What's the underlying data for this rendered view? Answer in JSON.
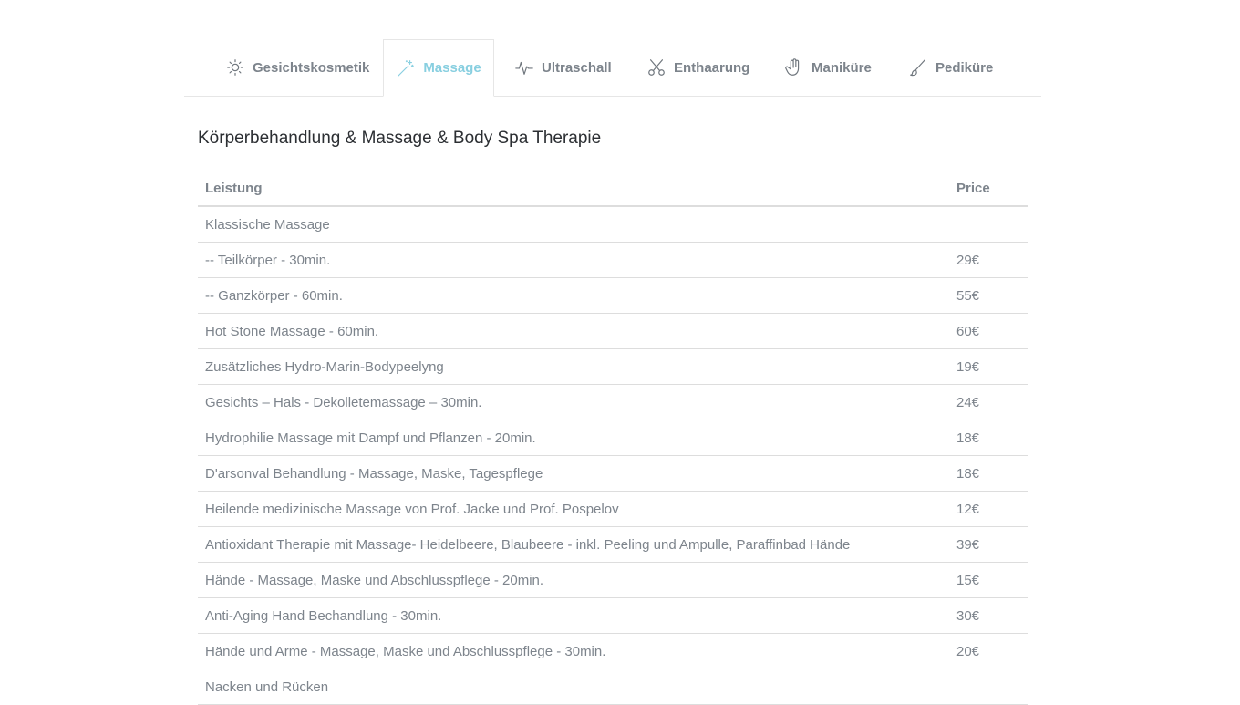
{
  "tabs": [
    {
      "label": "Gesichtskosmetik",
      "icon": "sun-icon"
    },
    {
      "label": "Massage",
      "icon": "magic-wand-icon",
      "active": true
    },
    {
      "label": "Ultraschall",
      "icon": "pulse-icon"
    },
    {
      "label": "Enthaarung",
      "icon": "scissors-icon"
    },
    {
      "label": "Maniküre",
      "icon": "hand-icon"
    },
    {
      "label": "Pediküre",
      "icon": "brush-icon"
    }
  ],
  "colors": {
    "accent": "#88cfe0",
    "text": "#7d848c",
    "title": "#2c2f33",
    "border": "#dddddd"
  },
  "section": {
    "title": "Körperbehandlung & Massage & Body Spa Therapie"
  },
  "table": {
    "headers": {
      "service": "Leistung",
      "price": "Price"
    },
    "rows": [
      {
        "service": "Klassische Massage",
        "price": ""
      },
      {
        "service": "-- Teilkörper - 30min.",
        "price": "29€"
      },
      {
        "service": "-- Ganzkörper - 60min.",
        "price": "55€"
      },
      {
        "service": "Hot Stone Massage - 60min.",
        "price": "60€"
      },
      {
        "service": "Zusätzliches Hydro-Marin-Bodypeelyng",
        "price": "19€"
      },
      {
        "service": "Gesichts – Hals - Dekolletemassage – 30min.",
        "price": "24€"
      },
      {
        "service": "Hydrophilie Massage mit Dampf und Pflanzen - 20min.",
        "price": "18€"
      },
      {
        "service": "D'arsonval Behandlung - Massage, Maske, Tagespflege",
        "price": "18€"
      },
      {
        "service": "Heilende medizinische Massage von Prof. Jacke und Prof. Pospelov",
        "price": "12€"
      },
      {
        "service": "Antioxidant Therapie mit Massage- Heidelbeere, Blaubeere - inkl. Peeling und Ampulle, Paraffinbad Hände",
        "price": "39€"
      },
      {
        "service": "Hände - Massage, Maske und Abschlusspflege - 20min.",
        "price": "15€"
      },
      {
        "service": "Anti-Aging Hand Bechandlung - 30min.",
        "price": "30€"
      },
      {
        "service": "Hände und Arme - Massage, Maske und Abschlusspflege - 30min.",
        "price": "20€"
      },
      {
        "service": "Nacken und Rücken",
        "price": ""
      }
    ]
  }
}
